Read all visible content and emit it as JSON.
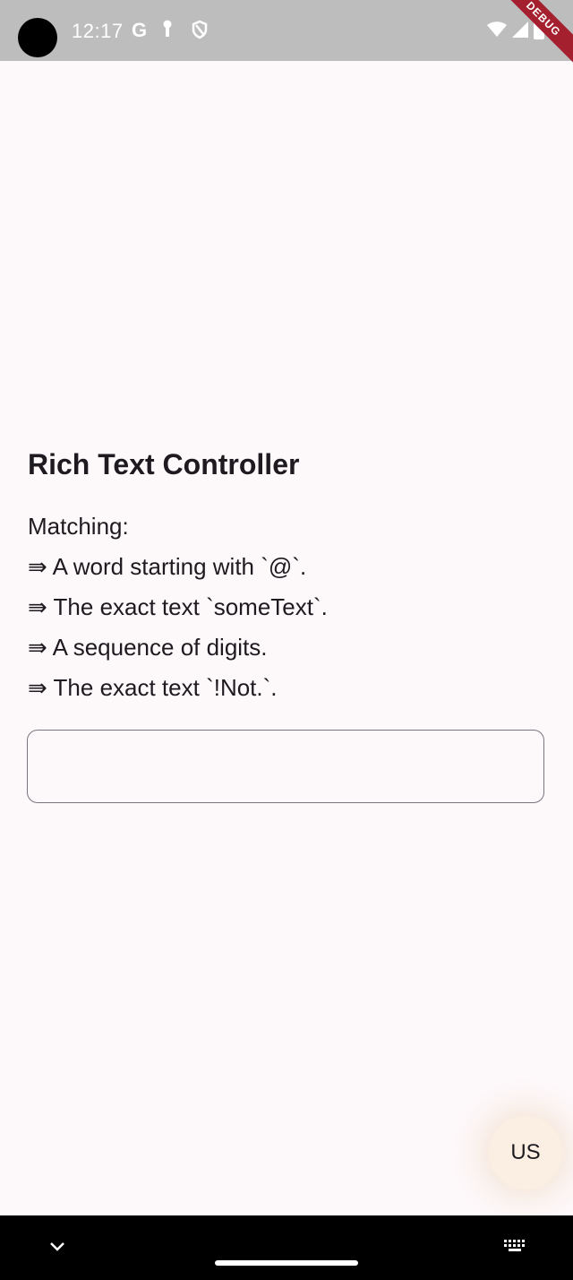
{
  "status_bar": {
    "time": "12:17",
    "icons": [
      "google-icon",
      "key-icon",
      "shield-icon",
      "wifi-icon",
      "signal-icon",
      "battery-icon"
    ],
    "debug_label": "DEBUG"
  },
  "page": {
    "title": "Rich Text Controller",
    "matching_lines": [
      "Matching:",
      "⇛ A word starting with `@`.",
      "⇛ The exact text `someText`.",
      "⇛ A sequence of digits.",
      "⇛ The exact text `!Not.`."
    ],
    "input_value": ""
  },
  "fab": {
    "label": "US"
  },
  "nav_bar": {
    "icons": [
      "chevron-down-icon",
      "keyboard-icon"
    ]
  },
  "colors": {
    "background": "#fdf8fa",
    "status_bar": "#bdbdbd",
    "fab": "#fbeee2",
    "debug_banner": "#a5202e",
    "text": "#1d1b20"
  }
}
